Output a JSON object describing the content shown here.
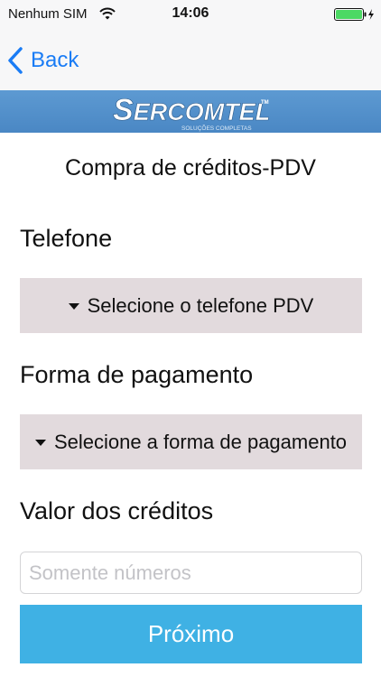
{
  "status_bar": {
    "carrier": "Nenhum SIM",
    "time": "14:06",
    "wifi_icon": "wifi-icon",
    "battery_icon": "battery-charging-icon",
    "battery_color": "#4cd964"
  },
  "nav_bar": {
    "back_label": "Back",
    "back_icon": "chevron-left-icon",
    "tint_color": "#1a7cf5"
  },
  "banner": {
    "brand": "SERCOMTEL",
    "brand_first": "S",
    "brand_rest": "ERCOMTEL",
    "trademark": "TM",
    "tagline": "SOLUÇÕES COMPLETAS",
    "background_color": "#4f8dca"
  },
  "form": {
    "title": "Compra de créditos-PDV",
    "phone": {
      "label": "Telefone",
      "select_text": "Selecione o telefone PDV"
    },
    "payment": {
      "label": "Forma de pagamento",
      "select_text": "Selecione a forma de pagamento"
    },
    "value": {
      "label": "Valor dos créditos",
      "value": "",
      "placeholder": "Somente números"
    },
    "next_label": "Próximo",
    "select_background": "#e2dadd",
    "button_color": "#3fb1e4"
  }
}
